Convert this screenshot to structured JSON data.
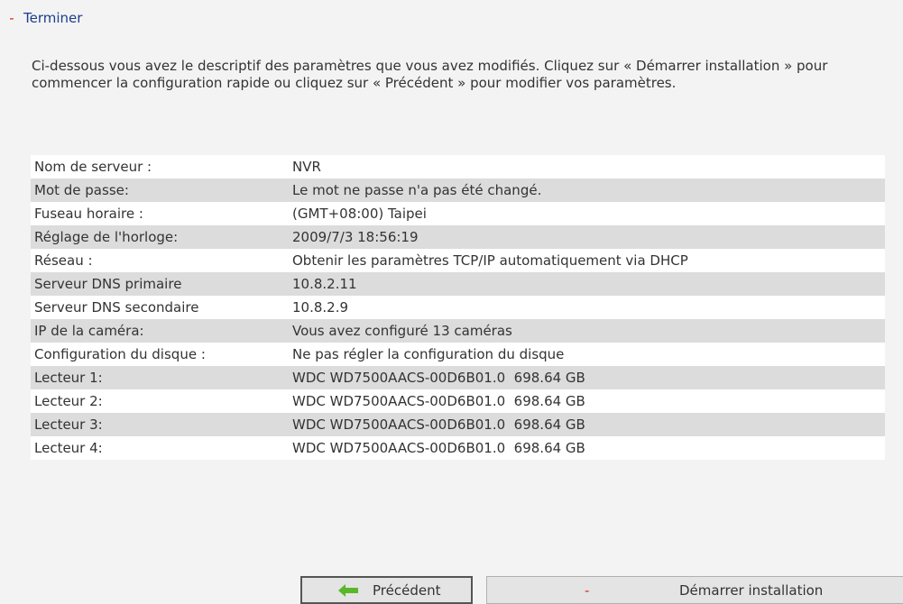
{
  "header": {
    "marker": "-",
    "title": "Terminer"
  },
  "description": "Ci-dessous vous avez le descriptif des paramètres que vous avez modifiés. Cliquez sur « Démarrer installation » pour commencer la configuration rapide ou cliquez sur « Précédent » pour modifier vos paramètres.",
  "summary": {
    "rows": [
      {
        "label": "Nom de serveur :",
        "value": "NVR"
      },
      {
        "label": "Mot de passe:",
        "value": "Le mot ne passe n'a pas été changé."
      },
      {
        "label": "Fuseau horaire :",
        "value": "(GMT+08:00) Taipei"
      },
      {
        "label": "Réglage de l'horloge:",
        "value": "2009/7/3 18:56:19"
      },
      {
        "label": "Réseau :",
        "value": "Obtenir les paramètres TCP/IP automatiquement via DHCP"
      },
      {
        "label": "Serveur DNS primaire",
        "value": "10.8.2.11"
      },
      {
        "label": "Serveur DNS secondaire",
        "value": "10.8.2.9"
      },
      {
        "label": "IP de la caméra:",
        "value": "Vous avez configuré 13 caméras"
      },
      {
        "label": "Configuration du disque :",
        "value": "Ne pas régler la configuration du disque"
      },
      {
        "label": "Lecteur 1:",
        "value": "WDC WD7500AACS-00D6B01.0  698.64 GB"
      },
      {
        "label": "Lecteur 2:",
        "value": "WDC WD7500AACS-00D6B01.0  698.64 GB"
      },
      {
        "label": "Lecteur 3:",
        "value": "WDC WD7500AACS-00D6B01.0  698.64 GB"
      },
      {
        "label": "Lecteur 4:",
        "value": "WDC WD7500AACS-00D6B01.0  698.64 GB"
      }
    ]
  },
  "buttons": {
    "previous_label": "Précédent",
    "previous_icon": "green-left-arrow-icon",
    "start_marker": "-",
    "start_label": "Démarrer installation"
  },
  "colors": {
    "title": "#1a3f8c",
    "marker": "#e02020",
    "arrow": "#58b82a",
    "row_alt": "#dcdcdc",
    "background": "#f3f3f3"
  }
}
